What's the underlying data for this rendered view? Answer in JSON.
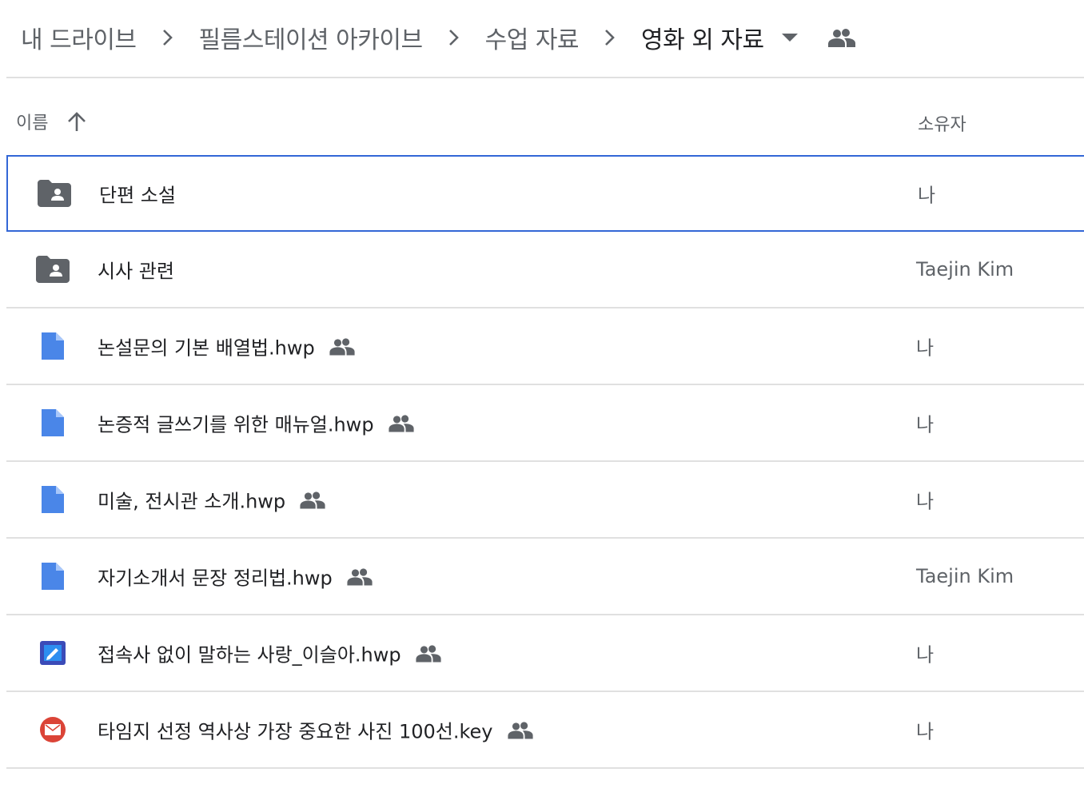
{
  "breadcrumb": {
    "items": [
      {
        "label": "내 드라이브"
      },
      {
        "label": "필름스테이션 아카이브"
      },
      {
        "label": "수업 자료"
      },
      {
        "label": "영화 외 자료"
      }
    ],
    "current_icon": "people-icon"
  },
  "columns": {
    "name": "이름",
    "sort_icon": "arrow-up-icon",
    "owner": "소유자"
  },
  "files": [
    {
      "name": "단편 소설",
      "type": "shared-folder",
      "icon": "shared-folder-icon",
      "shared": false,
      "owner": "나",
      "selected": true
    },
    {
      "name": "시사 관련",
      "type": "shared-folder",
      "icon": "shared-folder-icon",
      "shared": false,
      "owner": "Taejin Kim",
      "selected": false
    },
    {
      "name": "논설문의 기본 배열법.hwp",
      "type": "document",
      "icon": "document-icon",
      "shared": true,
      "owner": "나",
      "selected": false
    },
    {
      "name": "논증적 글쓰기를 위한 매뉴얼.hwp",
      "type": "document",
      "icon": "document-icon",
      "shared": true,
      "owner": "나",
      "selected": false
    },
    {
      "name": "미술, 전시관 소개.hwp",
      "type": "document",
      "icon": "document-icon",
      "shared": true,
      "owner": "나",
      "selected": false
    },
    {
      "name": "자기소개서 문장 정리법.hwp",
      "type": "document",
      "icon": "document-icon",
      "shared": true,
      "owner": "Taejin Kim",
      "selected": false
    },
    {
      "name": "접속사 없이 말하는 사랑_이슬아.hwp",
      "type": "hwp",
      "icon": "hwp-app-icon",
      "shared": true,
      "owner": "나",
      "selected": false
    },
    {
      "name": "타임지 선정 역사상 가장 중요한 사진 100선.key",
      "type": "keynote",
      "icon": "keynote-icon",
      "shared": true,
      "owner": "나",
      "selected": false
    }
  ],
  "colors": {
    "selection_border": "#3367d6",
    "doc_blue": "#4a86e8",
    "folder_gray": "#5f6368",
    "keynote_red": "#db4437"
  }
}
